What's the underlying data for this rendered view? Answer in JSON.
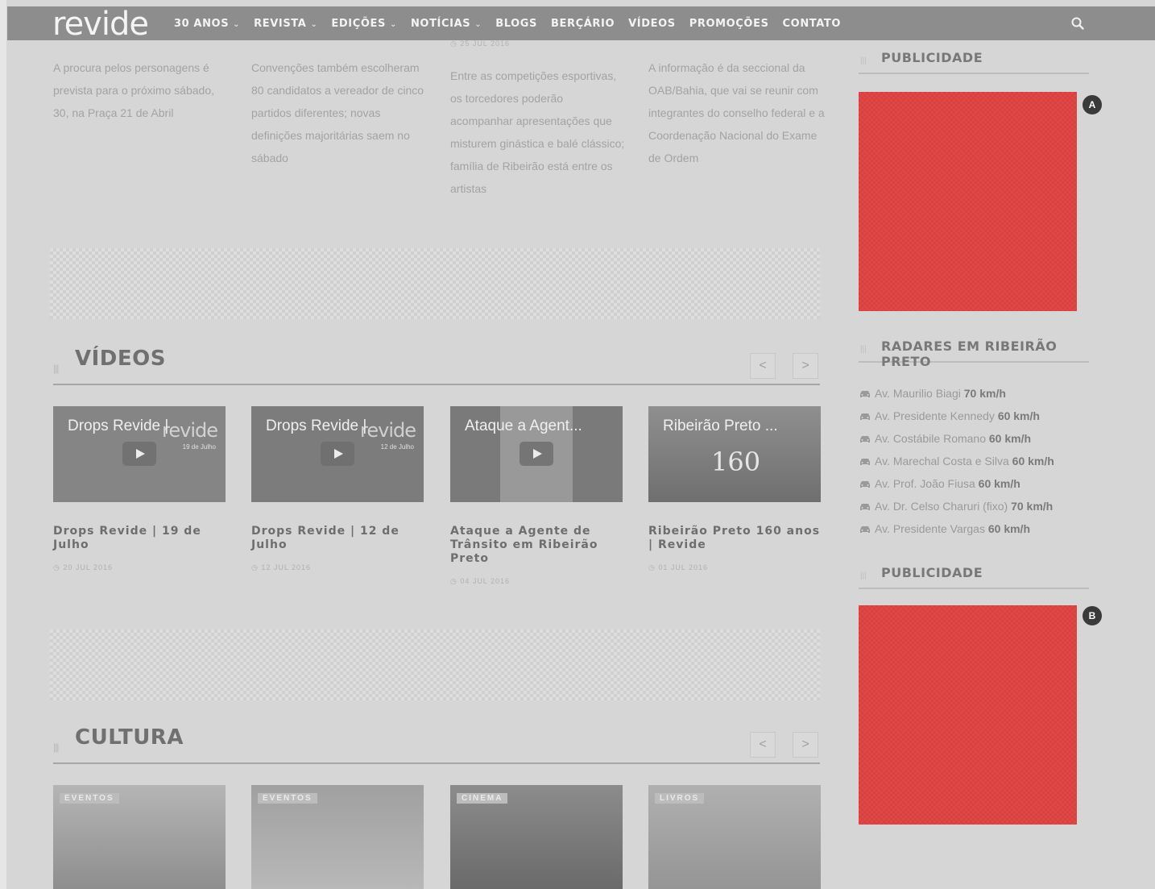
{
  "nav": {
    "logo": "revide",
    "items": [
      {
        "label": "30 ANOS",
        "dropdown": true
      },
      {
        "label": "REVISTA",
        "dropdown": true
      },
      {
        "label": "EDIÇÕES",
        "dropdown": true
      },
      {
        "label": "NOTÍCIAS",
        "dropdown": true
      },
      {
        "label": "BLOGS",
        "dropdown": false
      },
      {
        "label": "BERÇÁRIO",
        "dropdown": false
      },
      {
        "label": "VÍDEOS",
        "dropdown": false
      },
      {
        "label": "PROMOÇÕES",
        "dropdown": false
      },
      {
        "label": "CONTATO",
        "dropdown": false
      }
    ],
    "search_icon": "search-icon"
  },
  "teasers": [
    {
      "text": "A procura pelos personagens é prevista para o próximo sábado, 30, na Praça 21 de Abril"
    },
    {
      "text": "Convenções também escolheram 80 candidatos a vereador de cinco partidos diferentes; novas definições majoritárias saem no sábado"
    },
    {
      "date": "25 JUL 2016",
      "text": "Entre as competições esportivas, os torcedores poderão acompanhar apresentações que misturem ginástica e balé clássico; família de Ribeirão está entre os artistas"
    },
    {
      "text": "A informação é da seccional da OAB/Bahia, que vai se reunir com integrantes do conselho federal e a Coordenação Nacional do Exame de Ordem"
    }
  ],
  "videos": {
    "title": "VÍDEOS",
    "prev": "<",
    "next": ">",
    "items": [
      {
        "thumb_title": "Drops Revide |",
        "thumb_brand": "revide",
        "thumb_sub": "19 de Julho",
        "title": "Drops Revide | 19 de Julho",
        "date": "20 JUL 2016"
      },
      {
        "thumb_title": "Drops Revide |",
        "thumb_brand": "revide",
        "thumb_sub": "12 de Julho",
        "title": "Drops Revide | 12 de Julho",
        "date": "12 JUL 2016"
      },
      {
        "thumb_title": "Ataque a Agent...",
        "title": "Ataque a Agente de Trânsito em Ribeirão Preto",
        "date": "04 JUL 2016"
      },
      {
        "thumb_title": "Ribeirão Preto ...",
        "thumb_big": "160",
        "title": "Ribeirão Preto 160 anos | Revide",
        "date": "01 JUL 2016"
      }
    ]
  },
  "cultura": {
    "title": "CULTURA",
    "prev": "<",
    "next": ">",
    "items": [
      {
        "category": "EVENTOS"
      },
      {
        "category": "EVENTOS"
      },
      {
        "category": "CINEMA"
      },
      {
        "category": "LIVROS"
      }
    ]
  },
  "sidebar": {
    "ad1_title": "PUBLICIDADE",
    "ad1_marker": "A",
    "radar_title": "RADARES EM RIBEIRÃO PRETO",
    "radars": [
      {
        "street": "Av. Maurilio Biagi",
        "speed": "70 km/h"
      },
      {
        "street": "Av. Presidente Kennedy",
        "speed": "60 km/h"
      },
      {
        "street": "Av. Costábile Romano",
        "speed": "60 km/h"
      },
      {
        "street": "Av. Marechal Costa e Silva",
        "speed": "60 km/h"
      },
      {
        "street": "Av. Prof. João Fiusa",
        "speed": "60 km/h"
      },
      {
        "street": "Av. Dr. Celso Charuri (fixo)",
        "speed": "70 km/h"
      },
      {
        "street": "Av. Presidente Vargas",
        "speed": "60 km/h"
      }
    ],
    "ad2_title": "PUBLICIDADE",
    "ad2_marker": "B"
  }
}
